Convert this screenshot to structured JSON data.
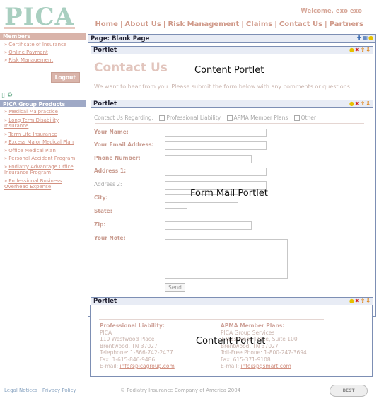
{
  "header": {
    "logo_text": "PICA",
    "welcome": "Welcome, exo exo",
    "nav": [
      "Home",
      "About Us",
      "Risk Management",
      "Claims",
      "Contact Us",
      "Partners"
    ]
  },
  "sidebar": {
    "members_title": "Members",
    "member_links": [
      "Certificate of Insurance",
      "Online Payment",
      "Risk Management"
    ],
    "logout_label": "Logout",
    "products_title": "PICA Group Products",
    "product_links": [
      "Medical Malpractice",
      "Long Term Disability Insurance",
      "Term Life Insurance",
      "Excess Major Medical Plan",
      "Office Medical Plan",
      "Personal Accident Program",
      "Podiatry Advantage Office Insurance Program",
      "Professional Business Overhead Expense"
    ]
  },
  "page": {
    "title": "Page: Blank Page"
  },
  "portlets": {
    "label": "Portlet",
    "p1": {
      "overlay": "Content Portlet",
      "heading": "Contact Us",
      "subtext": "We want to hear from you. Please submit the form below with any comments or questions."
    },
    "p2": {
      "overlay": "Form Mail Portlet",
      "regarding_label": "Contact Us Regarding:",
      "options": [
        "Professional Liability",
        "APMA Member Plans",
        "Other"
      ],
      "fields": {
        "name": "Your Name:",
        "email": "Your Email Address:",
        "phone": "Phone Number:",
        "address1": "Address 1:",
        "address2": "Address 2:",
        "city": "City:",
        "state": "State:",
        "zip": "Zip:",
        "note": "Your Note:"
      },
      "send_label": "Send"
    },
    "p3": {
      "overlay": "Content Portlet",
      "left": {
        "heading": "Professional Liability:",
        "lines": [
          "PICA",
          "110 Westwood Place",
          "Brentwood, TN 37027",
          "Telephone: 1-866-742-2477",
          "Fax: 1-615-846-9486"
        ],
        "email_prefix": "E-mail:",
        "email": "info@picagroup.com"
      },
      "right": {
        "heading": "APMA Member Plans:",
        "lines": [
          "PICA Group Services",
          "1 Westwood Place, Suite 100",
          "Brentwood, TN 37027",
          "Toll-Free Phone: 1-800-247-3694",
          "Fax: 615-371-9108"
        ],
        "email_prefix": "E-mail:",
        "email": "info@pgsmart.com"
      }
    }
  },
  "footer": {
    "legal": "Legal Notices",
    "privacy": "Privacy Policy",
    "copyright": "© Podiatry Insurance Company of America 2004",
    "badge": "BEST"
  }
}
